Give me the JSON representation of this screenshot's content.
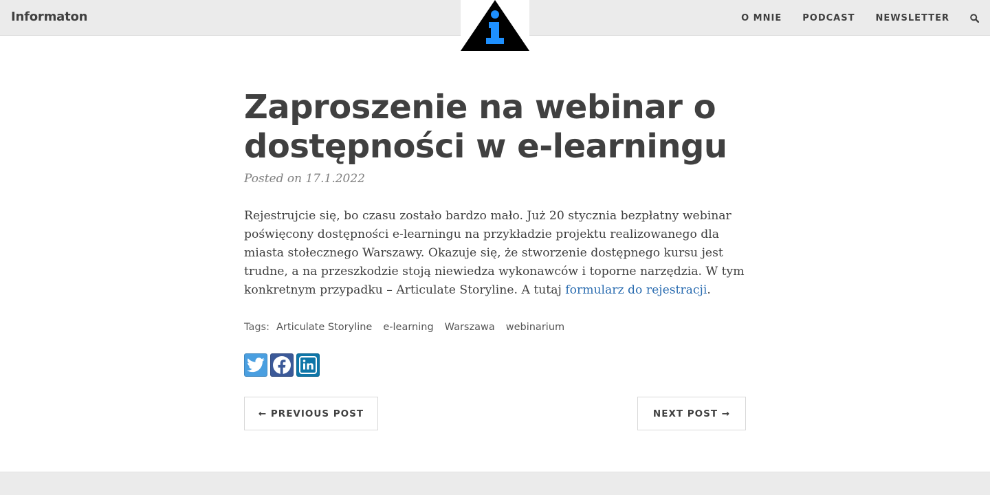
{
  "header": {
    "brand": "Informaton",
    "logo_icon": "info-triangle-logo",
    "nav": [
      {
        "label": "O MNIE"
      },
      {
        "label": "PODCAST"
      },
      {
        "label": "NEWSLETTER"
      }
    ],
    "search_icon": "search-icon"
  },
  "post": {
    "title": "Zaproszenie na webinar o dostępności w e-learningu",
    "meta": "Posted on 17.1.2022",
    "body_text": "Rejestrujcie się, bo czasu zostało bardzo mało. Już 20 stycznia bezpłatny webinar poświęcony dostępności e-learningu na przykładzie projektu realizowanego dla miasta stołecznego Warszawy. Okazuje się, że stworzenie dostępnego kursu jest trudne, a na przeszkodzie stoją niewiedza wykonawców i toporne narzędzia. W tym konkretnym przypadku – Articulate Storyline. A tutaj ",
    "body_link": "formularz do rejestracji",
    "body_end": ".",
    "tags_label": "Tags:",
    "tags": [
      "Articulate Storyline",
      "e-learning",
      "Warszawa",
      "webinarium"
    ]
  },
  "share": {
    "twitter_icon": "twitter-icon",
    "facebook_icon": "facebook-icon",
    "linkedin_icon": "linkedin-icon"
  },
  "pager": {
    "prev": "← PREVIOUS POST",
    "next": "NEXT POST →"
  },
  "colors": {
    "header_bg": "#ebebeb",
    "text": "#404040",
    "link": "#2a6cb0",
    "logo_accent": "#1e90ff"
  }
}
